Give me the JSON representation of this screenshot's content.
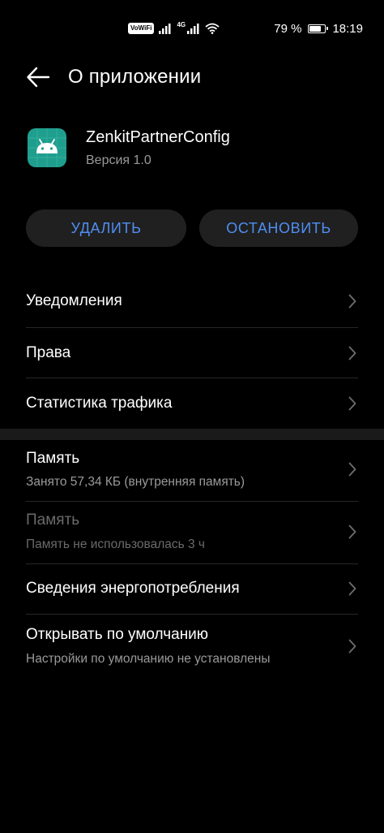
{
  "status_bar": {
    "network_badge": "VoWiFi",
    "signal_label": "4G",
    "battery": "79 %",
    "battery_level": 0.79,
    "time": "18:19"
  },
  "header": {
    "title": "О приложении"
  },
  "app": {
    "name": "ZenkitPartnerConfig",
    "version": "Версия 1.0",
    "icon_color": "#1f9e8e"
  },
  "actions": {
    "delete_label": "УДАЛИТЬ",
    "stop_label": "ОСТАНОВИТЬ",
    "accent_color": "#4f8ef2"
  },
  "settings": {
    "notifications": "Уведомления",
    "permissions": "Права",
    "traffic": "Статистика трафика"
  },
  "details": {
    "storage_title": "Память",
    "storage_sub": "Занято 57,34 КБ (внутренняя память)",
    "memory_title": "Память",
    "memory_sub": "Память не использовалась 3 ч",
    "power_title": "Сведения энергопотребления",
    "default_title": "Открывать по умолчанию",
    "default_sub": "Настройки по умолчанию не установлены"
  }
}
